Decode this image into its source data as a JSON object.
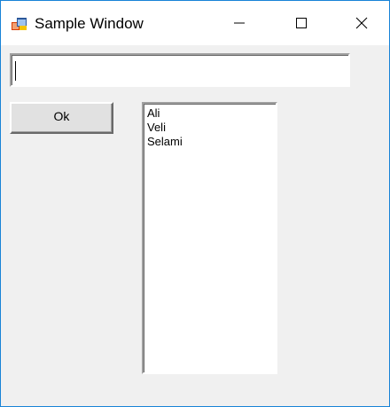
{
  "window": {
    "title": "Sample Window",
    "accent_color": "#1883d7"
  },
  "titlebar": {
    "icons": {
      "app": "app-form-icon",
      "minimize": "minimize-icon",
      "maximize": "maximize-icon",
      "close": "close-icon"
    }
  },
  "form": {
    "textbox": {
      "value": ""
    },
    "ok_label": "Ok",
    "list": {
      "items": [
        "Ali",
        "Veli",
        "Selami"
      ]
    }
  }
}
